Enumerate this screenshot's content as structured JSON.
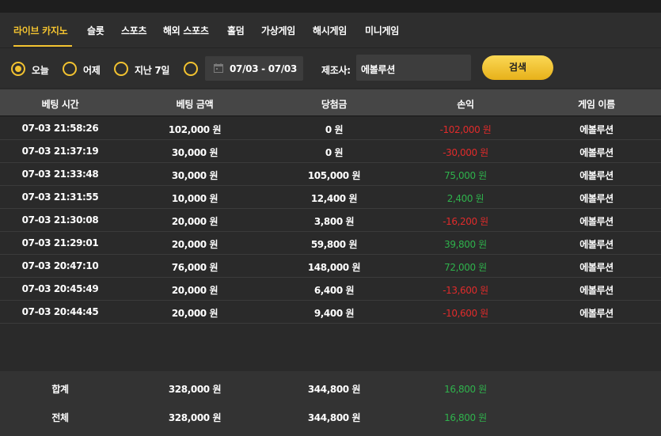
{
  "tabs": [
    {
      "label": "라이브 카지노",
      "active": true
    },
    {
      "label": "슬롯"
    },
    {
      "label": "스포츠"
    },
    {
      "label": "해외 스포츠"
    },
    {
      "label": "홀덤"
    },
    {
      "label": "가상게임"
    },
    {
      "label": "해시게임"
    },
    {
      "label": "미니게임"
    }
  ],
  "filters": {
    "periods": [
      {
        "label": "오늘",
        "checked": true
      },
      {
        "label": "어제",
        "checked": false
      },
      {
        "label": "지난 7일",
        "checked": false
      },
      {
        "label": "",
        "checked": false
      }
    ],
    "date_range": "07/03 - 07/03",
    "maker_label": "제조사:",
    "maker_value": "에볼루션",
    "search_label": "검색"
  },
  "table": {
    "columns": [
      "베팅 시간",
      "베팅 금액",
      "당첨금",
      "손익",
      "게임 이름"
    ],
    "rows": [
      {
        "time": "07-03 21:58:26",
        "bet": "102,000 원",
        "win": "0 원",
        "profit": "-102,000 원",
        "game": "에볼루션"
      },
      {
        "time": "07-03 21:37:19",
        "bet": "30,000 원",
        "win": "0 원",
        "profit": "-30,000 원",
        "game": "에볼루션"
      },
      {
        "time": "07-03 21:33:48",
        "bet": "30,000 원",
        "win": "105,000 원",
        "profit": "75,000 원",
        "game": "에볼루션"
      },
      {
        "time": "07-03 21:31:55",
        "bet": "10,000 원",
        "win": "12,400 원",
        "profit": "2,400 원",
        "game": "에볼루션"
      },
      {
        "time": "07-03 21:30:08",
        "bet": "20,000 원",
        "win": "3,800 원",
        "profit": "-16,200 원",
        "game": "에볼루션"
      },
      {
        "time": "07-03 21:29:01",
        "bet": "20,000 원",
        "win": "59,800 원",
        "profit": "39,800 원",
        "game": "에볼루션"
      },
      {
        "time": "07-03 20:47:10",
        "bet": "76,000 원",
        "win": "148,000 원",
        "profit": "72,000 원",
        "game": "에볼루션"
      },
      {
        "time": "07-03 20:45:49",
        "bet": "20,000 원",
        "win": "6,400 원",
        "profit": "-13,600 원",
        "game": "에볼루션"
      },
      {
        "time": "07-03 20:44:45",
        "bet": "20,000 원",
        "win": "9,400 원",
        "profit": "-10,600 원",
        "game": "에볼루션"
      }
    ]
  },
  "summary": {
    "subtotal": {
      "label": "합계",
      "bet": "328,000 원",
      "win": "344,800 원",
      "profit": "16,800 원"
    },
    "total": {
      "label": "전체",
      "bet": "328,000 원",
      "win": "344,800 원",
      "profit": "16,800 원"
    }
  },
  "colors": {
    "accent": "#f2c230",
    "loss": "#e02b2b",
    "gain": "#2fb24c"
  },
  "icons": {
    "date": "calendar-icon"
  }
}
